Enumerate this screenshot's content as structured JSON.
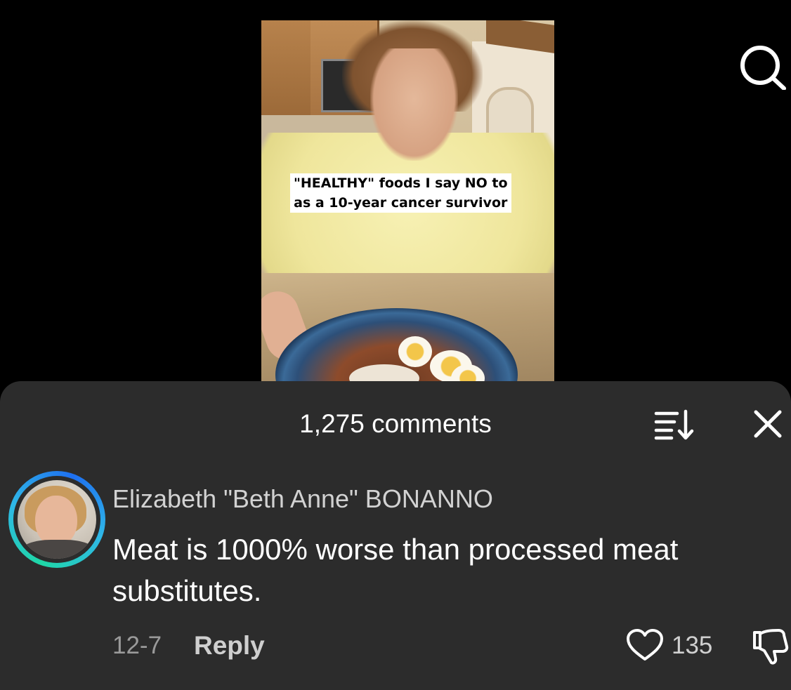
{
  "video": {
    "caption": "\"HEALTHY\" foods I say NO to\nas a 10-year cancer survivor"
  },
  "header": {
    "search_icon": "search-icon"
  },
  "comments": {
    "title": "1,275 comments",
    "sort_icon": "sort-icon",
    "close_icon": "close-icon",
    "items": [
      {
        "author": "Elizabeth \"Beth Anne\" BONANNO",
        "text": "Meat is 1000% worse than processed meat substitutes.",
        "date": "12-7",
        "reply_label": "Reply",
        "like_count": "135",
        "avatar_ring_colors": [
          "#1fd7a6",
          "#2fb7e8",
          "#1e6ff0"
        ]
      }
    ]
  },
  "colors": {
    "sheet_bg": "#2c2c2c",
    "page_bg": "#000000",
    "text_primary": "#ffffff",
    "text_secondary": "#d2d2d2",
    "text_muted": "#9a9a9a"
  }
}
